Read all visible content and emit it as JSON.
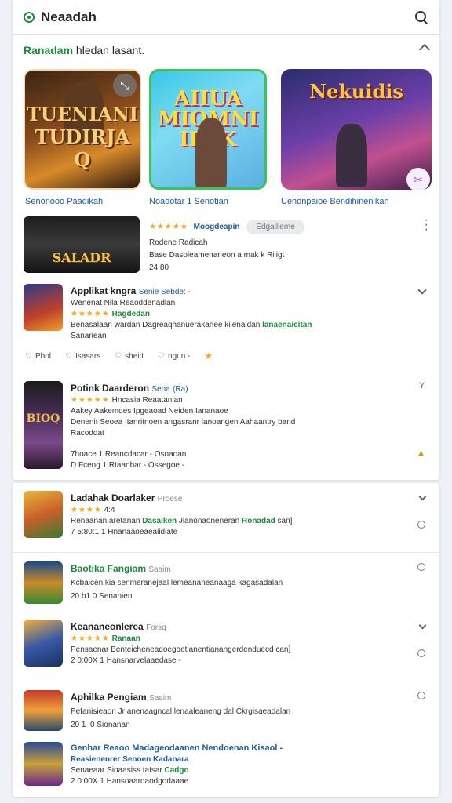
{
  "topbar": {
    "title": "Neaadah"
  },
  "section": {
    "title_green": "Ranadam",
    "title_rest": " hledan lasant."
  },
  "tiles": [
    {
      "art_text": "TUENIANI TUDIRJA Q",
      "label": "Senonooo Paadikah"
    },
    {
      "art_text": "AIIUA MIOMNI ILAK",
      "label": "Noaootar 1 Senotian"
    },
    {
      "art_text": "Nekuidis",
      "label": "Uenonpaioe Bendihinenikan"
    }
  ],
  "featured": {
    "art_text": "SALADR",
    "stars": "★★★★★",
    "rating_label": "Moogdeapin",
    "badge": "Edgailleme",
    "line1": "Rodene Radicah",
    "line2": "Base Dasoleamenaneon a mak k Riligt",
    "line3": "24 80"
  },
  "app1": {
    "name": "Applikat kngra",
    "tag": "Senie Sebde: -",
    "subtitle": "Wenenat Nila Reaoddenadlan",
    "stars": "★★★★★",
    "rating": "Ragdedan",
    "desc": "Benasalaan wardan Dagreaqhanuerakanee kilenaidan",
    "desc_green": "lanaenaicitan",
    "more": "Sanariean"
  },
  "actions": [
    "Pbol",
    "Isasars",
    "sheitt",
    "ngun -"
  ],
  "app2": {
    "art_text": "BIOQ",
    "name": "Potink Daarderon",
    "tag": "Sena",
    "tag2": "(Ra)",
    "stars": "★★★★★",
    "rating": "Hncasia Reaatanlan",
    "line1": "Aakey Aakemdes Ipgeaoad Neiden Iananaoe",
    "line2": "Denenit Seoea Itanritnoen angasranr lanoangen Aahaantry band",
    "line3": "Racoddat",
    "foot1": "7hoace 1 Reancdacar - Osnaoan",
    "foot2": "D  Fceng  1 Rtaanbar - Ossegoe -"
  },
  "list": [
    {
      "name": "Ladahak Doarlaker",
      "tag": "Proese",
      "stars": "★★★★",
      "rating": "4:4",
      "desc": "Renaanan aretanan",
      "desc_green": "Dasaiken",
      "desc_rest": "Jianonaoneneran",
      "desc_green2": "Ronadad",
      "desc_end": "san]",
      "foot": "7  5:80:1  1 Hnanaaoeaeaiidiate"
    },
    {
      "name": "Baotika Fangiam",
      "tag": "Saaim",
      "desc": "Kcbaicen kia senmeranejaal lemeananeanaaga kagasadalan",
      "foot": "20 b1 0  Senanien"
    },
    {
      "name": "Keananeonlerea",
      "tag": "Forsq",
      "stars": "★★★★★",
      "rating": "Ranaan",
      "desc": "Pensaenar Benteicheneadoegoetlanentianangerdenduecd can]",
      "foot": "2  0:00X  1 Hansnarvelaaedase -"
    },
    {
      "name": "Aphilka Pengiam",
      "tag": "Saaim",
      "desc": "Pefanisieaon Jr anenaagncal lenaaleaneng dal Ckrgisaeadalan",
      "foot": "20 1 :0  Sionanan"
    },
    {
      "name": "Genhar Reaoo Madageodaanen Nendoenan Kisaol -",
      "tag": "",
      "desc": "Reasienenrer Senoen Kadanara",
      "desc2": "Senaeaar Sioaasiss tatsar",
      "desc_green": "Cadgo",
      "foot": "2  0:00X  1 Hansoaardaodgodaaae"
    }
  ]
}
